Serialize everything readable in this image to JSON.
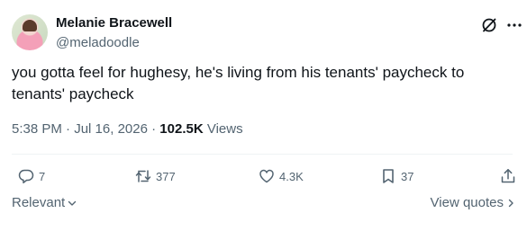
{
  "author": {
    "display_name": "Melanie Bracewell",
    "handle": "@meladoodle"
  },
  "tweet": {
    "text": "you gotta feel for hughesy, he's living from his tenants' paycheck to tenants' paycheck",
    "time": "5:38 PM",
    "separator1": " · ",
    "date": "Jul 16, 2026",
    "separator2": " · ",
    "views_count": "102.5K",
    "views_label": " Views"
  },
  "actions": {
    "replies": "7",
    "reposts": "377",
    "likes": "4.3K",
    "bookmarks": "37"
  },
  "footer": {
    "sort_label": "Relevant",
    "view_quotes_label": "View quotes"
  },
  "icons": {
    "grok": "grok-icon",
    "more": "more-icon",
    "reply": "reply-icon",
    "repost": "repost-icon",
    "like": "like-icon",
    "bookmark": "bookmark-icon",
    "share": "share-icon"
  },
  "colors": {
    "text": "#0f1419",
    "secondary": "#536471",
    "divider": "#eff3f4"
  }
}
